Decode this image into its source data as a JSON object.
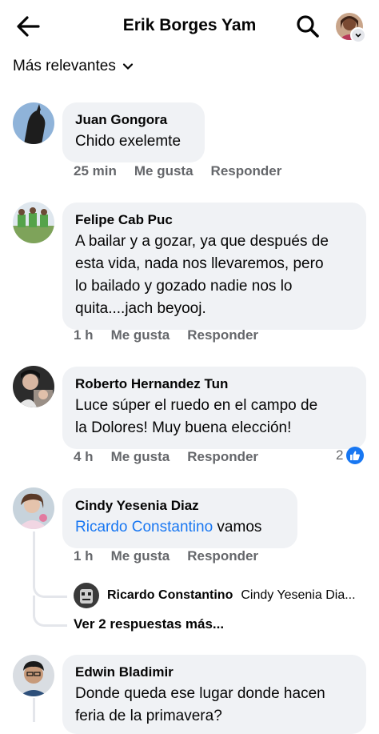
{
  "header": {
    "title": "Erik Borges Yam",
    "back_icon": "arrow-left-icon",
    "search_icon": "search-icon"
  },
  "sort": {
    "label": "Más relevantes"
  },
  "comments": [
    {
      "name": "Juan Gongora",
      "text": "Chido exelemte",
      "time": "25 min",
      "like": "Me gusta",
      "reply": "Responder"
    },
    {
      "name": "Felipe Cab Puc",
      "text": "A bailar y a gozar, ya que después de\nesta vida, nada nos llevaremos, pero\nlo bailado y gozado nadie nos lo\nquita....jach beyooj.",
      "time": "1 h",
      "like": "Me gusta",
      "reply": "Responder"
    },
    {
      "name": "Roberto Hernandez Tun",
      "text": "Luce súper el ruedo en el campo de\nla Dolores! Muy buena elección!",
      "time": "4 h",
      "like": "Me gusta",
      "reply": "Responder",
      "reaction_count": "2"
    },
    {
      "name": "Cindy Yesenia Diaz",
      "mention": "Ricardo Constantino",
      "text": " vamos",
      "time": "1 h",
      "like": "Me gusta",
      "reply": "Responder",
      "reply_preview": {
        "name": "Ricardo Constantino",
        "text": "Cindy Yesenia Dia..."
      },
      "more_replies": "Ver 2 respuestas más..."
    },
    {
      "name": "Edwin Bladimir",
      "text": "Donde queda ese lugar donde hacen\nferia de la primavera?"
    }
  ],
  "colors": {
    "link": "#1877f2",
    "bubble": "#f0f2f5",
    "meta": "#65676b"
  }
}
